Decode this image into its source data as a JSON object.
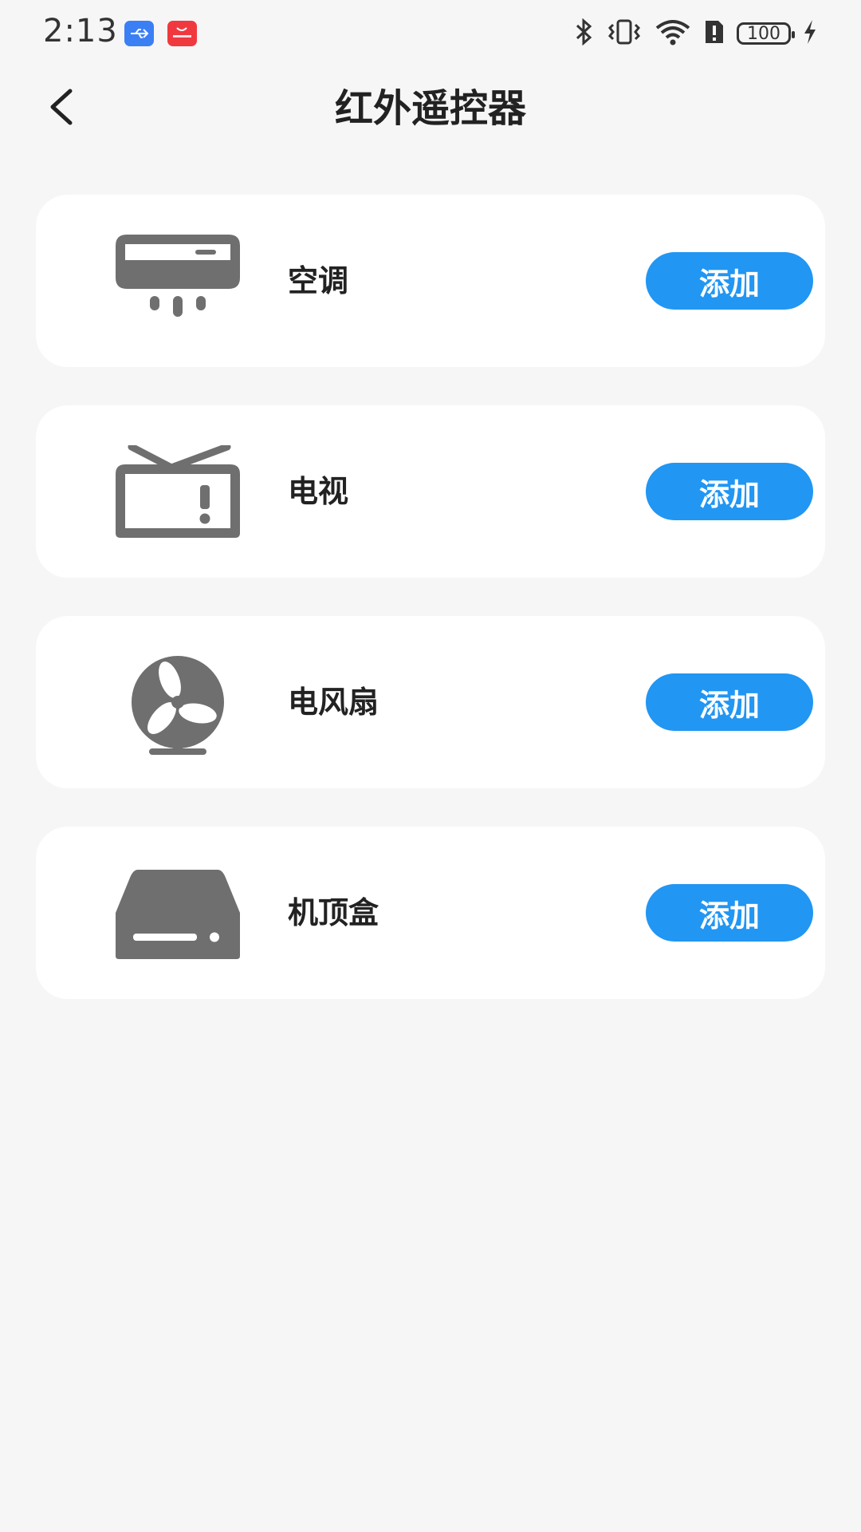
{
  "status_bar": {
    "time": "2:13",
    "battery": "100"
  },
  "header": {
    "title": "红外遥控器"
  },
  "devices": [
    {
      "label": "空调",
      "icon": "air-conditioner-icon",
      "button": "添加"
    },
    {
      "label": "电视",
      "icon": "tv-icon",
      "button": "添加"
    },
    {
      "label": "电风扇",
      "icon": "fan-icon",
      "button": "添加"
    },
    {
      "label": "机顶盒",
      "icon": "set-top-box-icon",
      "button": "添加"
    }
  ],
  "colors": {
    "accent": "#2196f3",
    "background": "#f6f6f6",
    "icon": "#6f6f6f"
  }
}
